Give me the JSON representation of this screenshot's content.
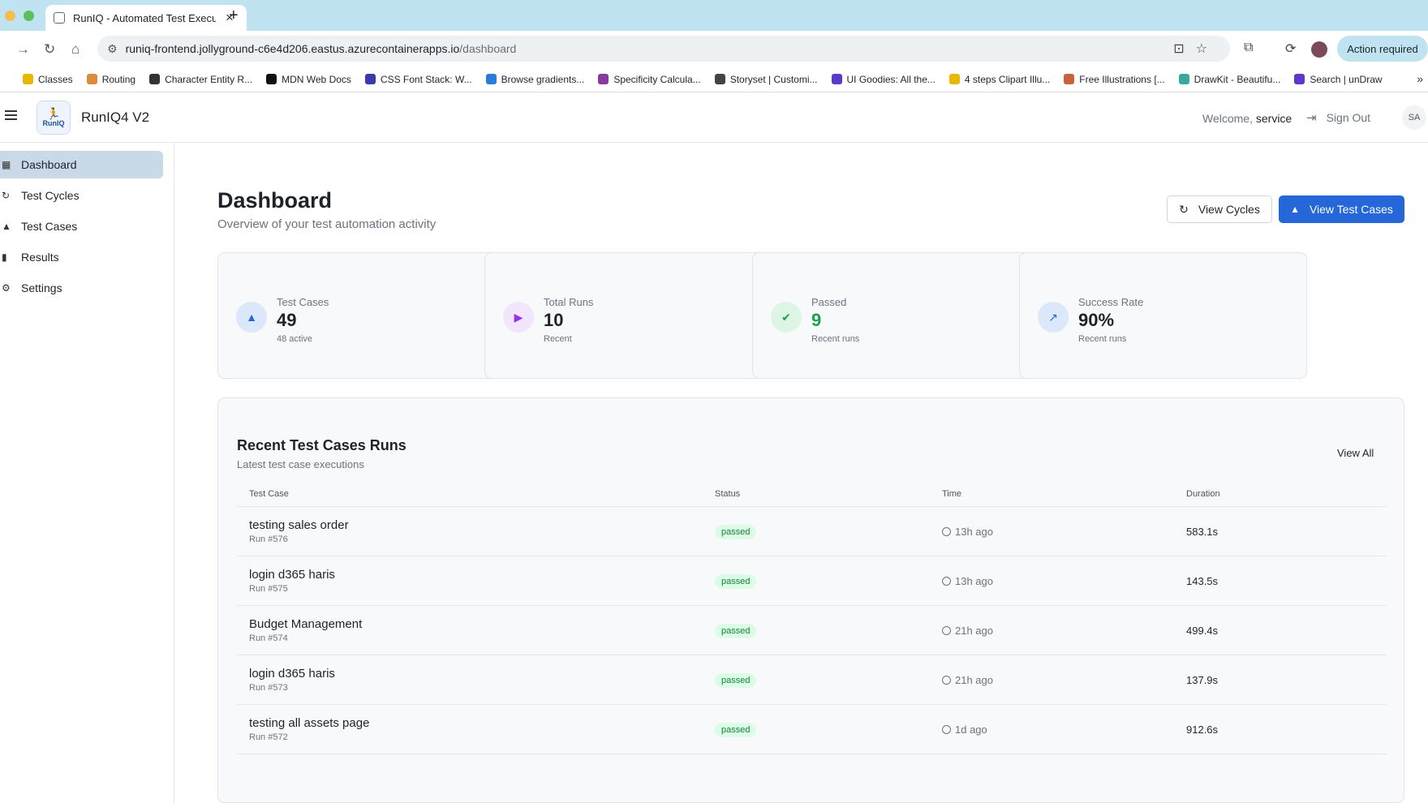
{
  "browser": {
    "tab_title": "RunIQ - Automated Test Execution",
    "url_host": "runiq-frontend.jollyground-c6e4d206.eastus.azurecontainerapps.io",
    "url_path": "/dashboard",
    "action_required": "Action required",
    "bookmarks": [
      {
        "label": "Classes",
        "color": "#e6b800"
      },
      {
        "label": "Routing",
        "color": "#d98c3a"
      },
      {
        "label": "Character Entity R...",
        "color": "#333333"
      },
      {
        "label": "MDN Web Docs",
        "color": "#111111"
      },
      {
        "label": "CSS Font Stack: W...",
        "color": "#3a3aa8"
      },
      {
        "label": "Browse gradients...",
        "color": "#2b7bd8"
      },
      {
        "label": "Specificity Calcula...",
        "color": "#8a3a9c"
      },
      {
        "label": "Storyset | Customi...",
        "color": "#444444"
      },
      {
        "label": "UI Goodies: All the...",
        "color": "#5b3ac9"
      },
      {
        "label": "4 steps Clipart Illu...",
        "color": "#e6b800"
      },
      {
        "label": "Free Illustrations [...",
        "color": "#c8643a"
      },
      {
        "label": "DrawKit - Beautifu...",
        "color": "#3aa8a0"
      },
      {
        "label": "Search | unDraw",
        "color": "#5b3ac9"
      }
    ]
  },
  "header": {
    "logo_text": "RunIQ",
    "app_title": "RunIQ4 V2",
    "welcome_prefix": "Welcome,",
    "welcome_user": "service",
    "sign_out": "Sign Out",
    "avatar": "SA"
  },
  "sidebar": {
    "items": [
      {
        "label": "Dashboard",
        "icon": "dashboard-icon",
        "active": true
      },
      {
        "label": "Test Cycles",
        "icon": "refresh-icon",
        "active": false
      },
      {
        "label": "Test Cases",
        "icon": "flask-icon",
        "active": false
      },
      {
        "label": "Results",
        "icon": "bar-chart-icon",
        "active": false
      },
      {
        "label": "Settings",
        "icon": "gear-icon",
        "active": false
      }
    ]
  },
  "main": {
    "title": "Dashboard",
    "subtitle": "Overview of your test automation activity",
    "btn_view_cycles": "View Cycles",
    "btn_view_test_cases": "View Test Cases",
    "stats": [
      {
        "label": "Test Cases",
        "value": "49",
        "sub": "48 active",
        "icon": "flask-icon",
        "color": "#2566d8",
        "bg": "#dbe7fb"
      },
      {
        "label": "Total Runs",
        "value": "10",
        "sub": "Recent",
        "icon": "play-icon",
        "color": "#9333ea",
        "bg": "#f1e6fb"
      },
      {
        "label": "Passed",
        "value": "9",
        "sub": "Recent runs",
        "icon": "check-circle-icon",
        "color": "#16a34a",
        "bg": "#dcf5e4"
      },
      {
        "label": "Success Rate",
        "value": "90%",
        "sub": "Recent runs",
        "icon": "trending-up-icon",
        "color": "#2566d8",
        "bg": "#dbe7fb"
      }
    ],
    "runs": {
      "title": "Recent Test Cases Runs",
      "subtitle": "Latest test case executions",
      "view_all": "View All",
      "columns": [
        "Test Case",
        "Status",
        "Time",
        "Duration"
      ],
      "rows": [
        {
          "name": "testing sales order",
          "run": "Run #576",
          "status": "passed",
          "time": "13h ago",
          "duration": "583.1s"
        },
        {
          "name": "login d365 haris",
          "run": "Run #575",
          "status": "passed",
          "time": "13h ago",
          "duration": "143.5s"
        },
        {
          "name": "Budget Management",
          "run": "Run #574",
          "status": "passed",
          "time": "21h ago",
          "duration": "499.4s"
        },
        {
          "name": "login d365 haris",
          "run": "Run #573",
          "status": "passed",
          "time": "21h ago",
          "duration": "137.9s"
        },
        {
          "name": "testing all assets page",
          "run": "Run #572",
          "status": "passed",
          "time": "1d ago",
          "duration": "912.6s"
        }
      ]
    }
  }
}
